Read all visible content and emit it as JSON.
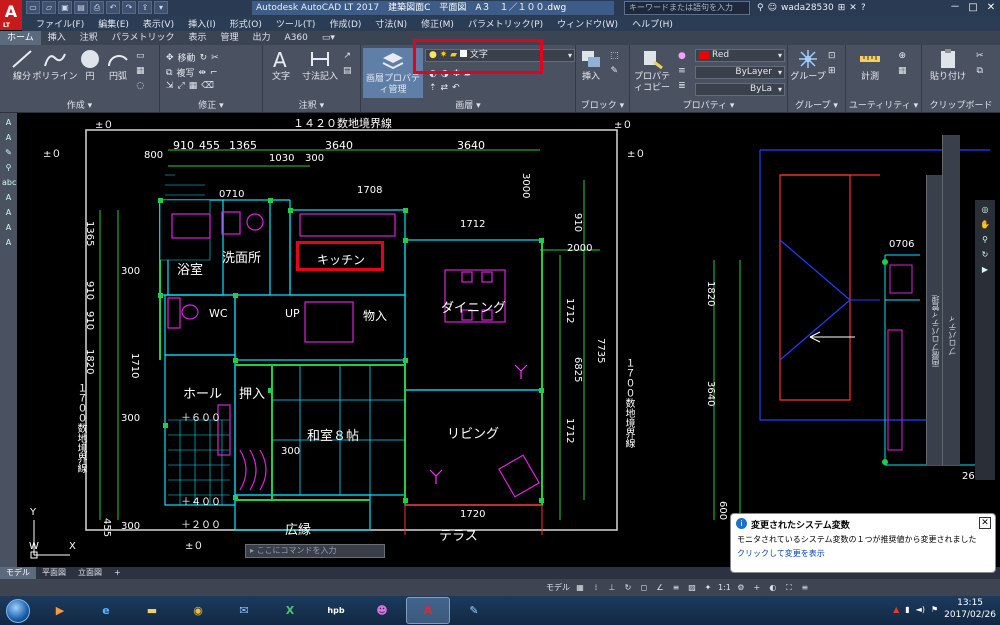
{
  "app": {
    "logo": "A",
    "logo_sub": "LT",
    "title_prefix": "Autodesk AutoCAD LT 2017",
    "title_doc": "建築図面C　平面図　A３　１／１００.dwg",
    "search_placeholder": "キーワードまたは語句を入力",
    "user": "wada28530",
    "win_controls": [
      "－",
      "□",
      "✕"
    ]
  },
  "menu": [
    "ファイル(F)",
    "編集(E)",
    "表示(V)",
    "挿入(I)",
    "形式(O)",
    "ツール(T)",
    "作成(D)",
    "寸法(N)",
    "修正(M)",
    "パラメトリック(P)",
    "ウィンドウ(W)",
    "ヘルプ(H)"
  ],
  "ribbon_tabs": [
    "ホーム",
    "挿入",
    "注釈",
    "パラメトリック",
    "表示",
    "管理",
    "出力",
    "A360"
  ],
  "ribbon": {
    "draw": {
      "title": "作成 ▾",
      "line": "線分",
      "polyline": "ポリライン",
      "circle": "円",
      "arc": "円弧"
    },
    "modify": {
      "title": "修正 ▾",
      "move": "移動",
      "copy": "複写"
    },
    "annotation": {
      "title": "注釈 ▾",
      "text": "文字",
      "dimension": "寸法記入"
    },
    "layers": {
      "title": "画層 ▾",
      "props_btn": "画層プロパティ管理",
      "current_layer": "文字"
    },
    "block": {
      "title": "ブロック ▾",
      "insert": "挿入"
    },
    "properties": {
      "title": "プロパティ ▾",
      "copy": "プロパティコピー",
      "color": "Red",
      "linetype": "ByLayer",
      "lineweight": "ByLa"
    },
    "group": {
      "title": "グループ ▾",
      "group": "グループ"
    },
    "utilities": {
      "title": "ユーティリティ ▾",
      "measure": "計測"
    },
    "clipboard": {
      "title": "クリップボード",
      "paste": "貼り付け"
    }
  },
  "drawing": {
    "top_boundary": "１４２０数地境界線",
    "right_boundary": "１７００数地境界線",
    "left_boundary": "１７００数地境界線",
    "plus_minus": "±０",
    "dims_top": [
      "910",
      "455",
      "1365",
      "3640",
      "3640"
    ],
    "dims_misc": [
      "800",
      "1030",
      "300",
      "0710",
      "1708",
      "3000",
      "1712",
      "2000",
      "910",
      "1365",
      "1820",
      "910",
      "910",
      "1710",
      "300",
      "1712",
      "6825",
      "7735",
      "1712",
      "300",
      "1720",
      "1820",
      "3640",
      "0706",
      "261",
      "600",
      "455",
      "300",
      "300"
    ],
    "rooms": {
      "bath": "浴室",
      "washroom": "洗面所",
      "kitchen": "キッチン",
      "dining": "ダイニング",
      "wc": "WC",
      "up": "UP",
      "storage": "物入",
      "hall": "ホール",
      "closet": "押入",
      "japanese_room": "和室８帖",
      "living": "リビング",
      "veranda": "広縁",
      "terrace": "テラス"
    },
    "levels": [
      "＋６００",
      "＋４００",
      "＋２００",
      "±０"
    ],
    "ucs_y": "Y",
    "ucs_x": "X",
    "ucs_w": "W"
  },
  "command_line": {
    "placeholder": "ここにコマンドを入力"
  },
  "palette": {
    "label1": "画層プロパティ管理",
    "label2": "プロパティ"
  },
  "balloon": {
    "title": "変更されたシステム変数",
    "body": "モニタされているシステム変数の１つが推奨値から変更されました",
    "link": "クリックして変更を表示"
  },
  "layout_tabs": [
    "モデル",
    "平面図",
    "立面図",
    "+"
  ],
  "status": {
    "model": "モデル",
    "scale": "1:1",
    "annot": "A 般"
  },
  "taskbar": {
    "apps": [
      "start",
      "media",
      "ie",
      "explorer",
      "chrome",
      "thunderbird",
      "excel",
      "hpb",
      "game",
      "autocad",
      "paint"
    ],
    "time": "13:15",
    "date": "2017/02/26"
  },
  "colors": {
    "accent": "#e8001a",
    "cyan": "#00e5ff",
    "green": "#20d040",
    "magenta": "#e020e0",
    "blue": "#2040ff"
  }
}
